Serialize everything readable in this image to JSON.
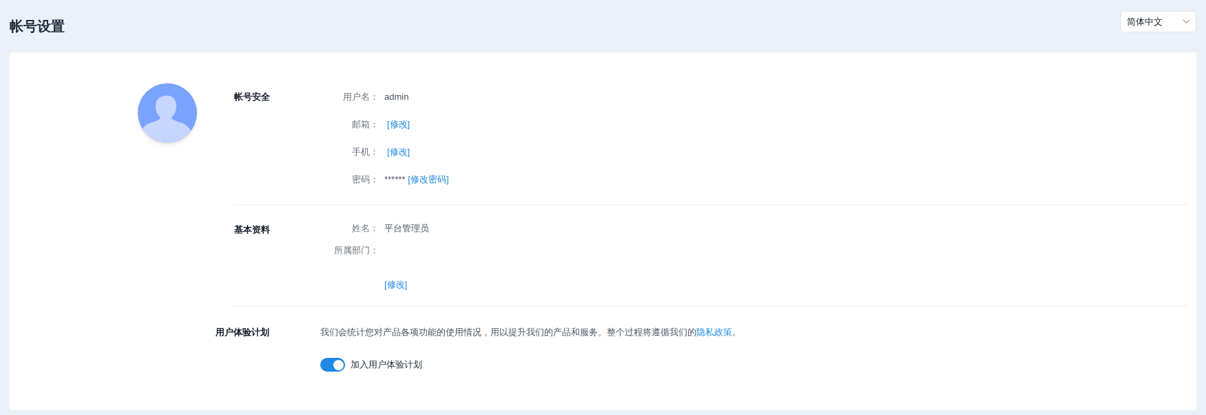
{
  "page": {
    "title": "帐号设置"
  },
  "language_select": {
    "value": "简体中文"
  },
  "account_security": {
    "heading": "帐号安全",
    "rows": [
      {
        "label": "用户名：",
        "value": "admin"
      },
      {
        "label": "邮箱：",
        "link": "[修改]"
      },
      {
        "label": "手机：",
        "link": "[修改]"
      },
      {
        "label": "密码：",
        "value": "******",
        "link": "[修改密码]"
      }
    ]
  },
  "basic_info": {
    "heading": "基本资料",
    "rows": [
      {
        "label": "姓名：",
        "value": "平台管理员"
      },
      {
        "label": "所属部门："
      }
    ],
    "edit_link": "[修改]"
  },
  "experience_plan": {
    "heading": "用户体验计划",
    "description": "我们会统计您对产品各项功能的使用情况，用以提升我们的产品和服务。整个过程将遵循我们的",
    "policy_link": "隐私政策",
    "description_end": "。",
    "toggle": {
      "label": "加入用户体验计划",
      "on": true
    }
  }
}
